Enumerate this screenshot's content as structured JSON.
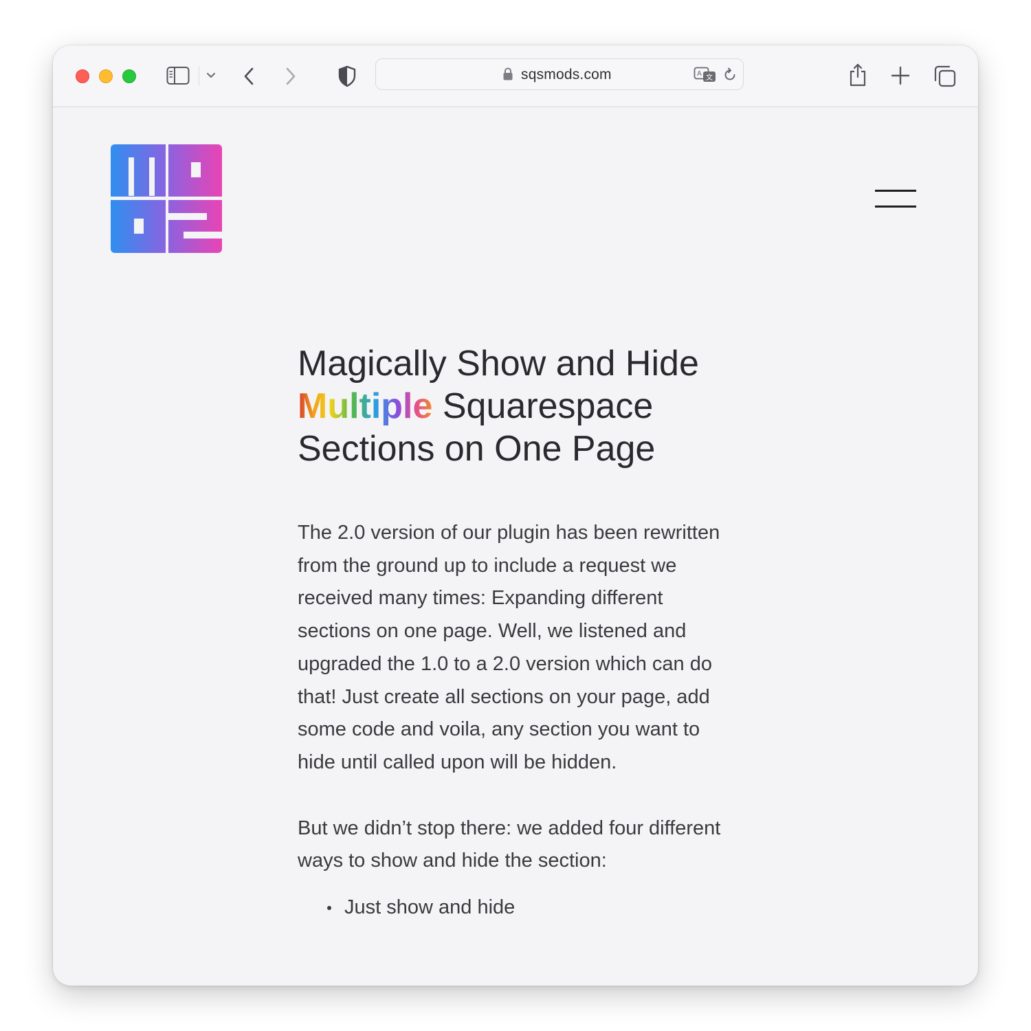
{
  "browser": {
    "url": "sqsmods.com",
    "icons": {
      "sidebar": "sidebar-icon",
      "sidebar_menu": "chevron-down-icon",
      "back": "chevron-left-icon",
      "forward": "chevron-right-icon",
      "privacy": "shield-icon",
      "lock": "lock-icon",
      "translate": "translate-icon",
      "reload": "reload-icon",
      "share": "share-icon",
      "new_tab": "plus-icon",
      "tabs": "tabs-overview-icon"
    }
  },
  "site": {
    "logo_text": "mods",
    "menu_icon": "hamburger-icon"
  },
  "article": {
    "headline_before": "Magically Show and Hide ",
    "headline_highlight": "Multiple",
    "headline_after": " Squarespace Sections on One Page",
    "paragraph_1": "The 2.0 version of our plugin has been rewritten from the ground up to include a request we received many times: Expanding different sections on one page. Well, we listened and upgraded the 1.0 to a 2.0 version which can do that! Just create all sections on your page, add some code and voila, any section you want to hide until called upon will be hidden.",
    "paragraph_2": "But we didn’t stop there: we added four different ways to show and hide the section:",
    "bullets": [
      "Just show and hide"
    ]
  },
  "colors": {
    "window_bg": "#f4f4f6",
    "text": "#2a2a2e",
    "logo_gradient_start": "#2f8ff0",
    "logo_gradient_mid": "#8a63e0",
    "logo_gradient_end": "#e944b4"
  }
}
